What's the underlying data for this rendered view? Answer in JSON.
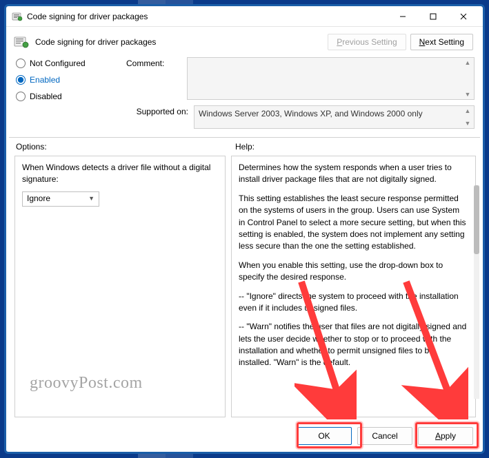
{
  "title": "Code signing for driver packages",
  "subheader": "Code signing for driver packages",
  "nav": {
    "prev_prefix": "P",
    "prev_rest": "revious Setting",
    "next_prefix": "N",
    "next_rest": "ext Setting"
  },
  "radios": {
    "not_configured_prefix": "Not ",
    "not_configured_ul": "C",
    "not_configured_rest": "onfigured",
    "enabled_ul": "E",
    "enabled_rest": "nabled",
    "disabled_ul": "D",
    "disabled_rest": "isabled"
  },
  "meta": {
    "comment_label": "Comment:",
    "comment_value": "",
    "supported_label": "Supported on:",
    "supported_value": "Windows Server 2003, Windows XP, and Windows 2000 only"
  },
  "panes": {
    "options_label": "Options:",
    "help_label": "Help:"
  },
  "options": {
    "text": "When Windows detects a driver file without a digital signature:",
    "select_value": "Ignore"
  },
  "help": {
    "p1": "Determines how the system responds when a user tries to install driver package files that are not digitally signed.",
    "p2": "This setting establishes the least secure response permitted on the systems of users in the group. Users can use System in Control Panel to select a more secure setting, but when this setting is enabled, the system does not implement any setting less secure than the one the setting established.",
    "p3": "When you enable this setting, use the drop-down box to specify the desired response.",
    "p4": "--   \"Ignore\" directs the system to proceed with the installation even if it includes unsigned files.",
    "p5": "--   \"Warn\" notifies the user that files are not digitally signed and lets the user decide whether to stop or to proceed with the installation and whether to permit unsigned files to be installed. \"Warn\" is the default."
  },
  "footer": {
    "ok": "OK",
    "cancel": "Cancel",
    "apply_ul": "A",
    "apply_rest": "pply"
  },
  "watermark": "groovyPost.com"
}
